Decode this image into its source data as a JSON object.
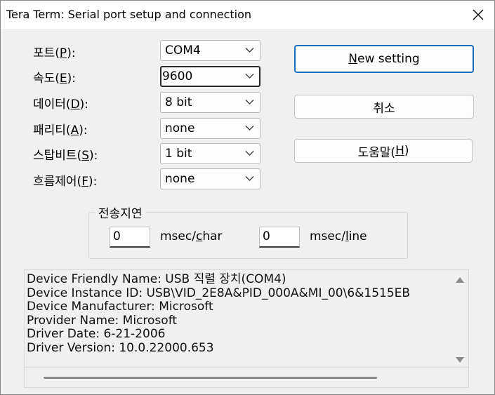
{
  "window": {
    "title": "Tera Term: Serial port setup and connection"
  },
  "fields": {
    "port": {
      "label_before": "포트(",
      "mnemonic": "P",
      "label_after": "):",
      "value": "COM4"
    },
    "speed": {
      "label_before": "속도(",
      "mnemonic": "E",
      "label_after": "):",
      "value": "9600"
    },
    "data": {
      "label_before": "데이터(",
      "mnemonic": "D",
      "label_after": "):",
      "value": "8 bit"
    },
    "parity": {
      "label_before": "패리티(",
      "mnemonic": "A",
      "label_after": "):",
      "value": "none"
    },
    "stop": {
      "label_before": "스탑비트(",
      "mnemonic": "S",
      "label_after": "):",
      "value": "1 bit"
    },
    "flow": {
      "label_before": "흐름제어(",
      "mnemonic": "F",
      "label_after": "):",
      "value": "none"
    }
  },
  "buttons": {
    "new_setting": {
      "mnemonic": "N",
      "rest": "ew setting"
    },
    "cancel": {
      "label": "취소"
    },
    "help": {
      "label_before": "도움말(",
      "mnemonic": "H",
      "label_after": ")"
    }
  },
  "delay": {
    "group_title": "전송지연",
    "char_value": "0",
    "char_unit_before": "msec/",
    "char_unit_mnemonic": "c",
    "char_unit_after": "har",
    "line_value": "0",
    "line_unit_before": "msec/",
    "line_unit_mnemonic": "l",
    "line_unit_after": "ine"
  },
  "device_info": {
    "lines": [
      "Device Friendly Name: USB 직렬 장치(COM4)",
      "Device Instance ID: USB\\VID_2E8A&PID_000A&MI_00\\6&1515EB",
      "Device Manufacturer: Microsoft",
      "Provider Name: Microsoft",
      "Driver Date: 6-21-2006",
      "Driver Version: 10.0.22000.653"
    ]
  },
  "icons": {
    "close": "close-icon",
    "dropdown": "chevron-down-icon",
    "scroll_up": "scroll-up-arrow-icon",
    "scroll_down": "scroll-down-arrow-icon"
  },
  "colors": {
    "window_bg": "#f0f0f0",
    "titlebar_bg": "#ffffff",
    "primary_button_border": "#1a6ec2"
  }
}
